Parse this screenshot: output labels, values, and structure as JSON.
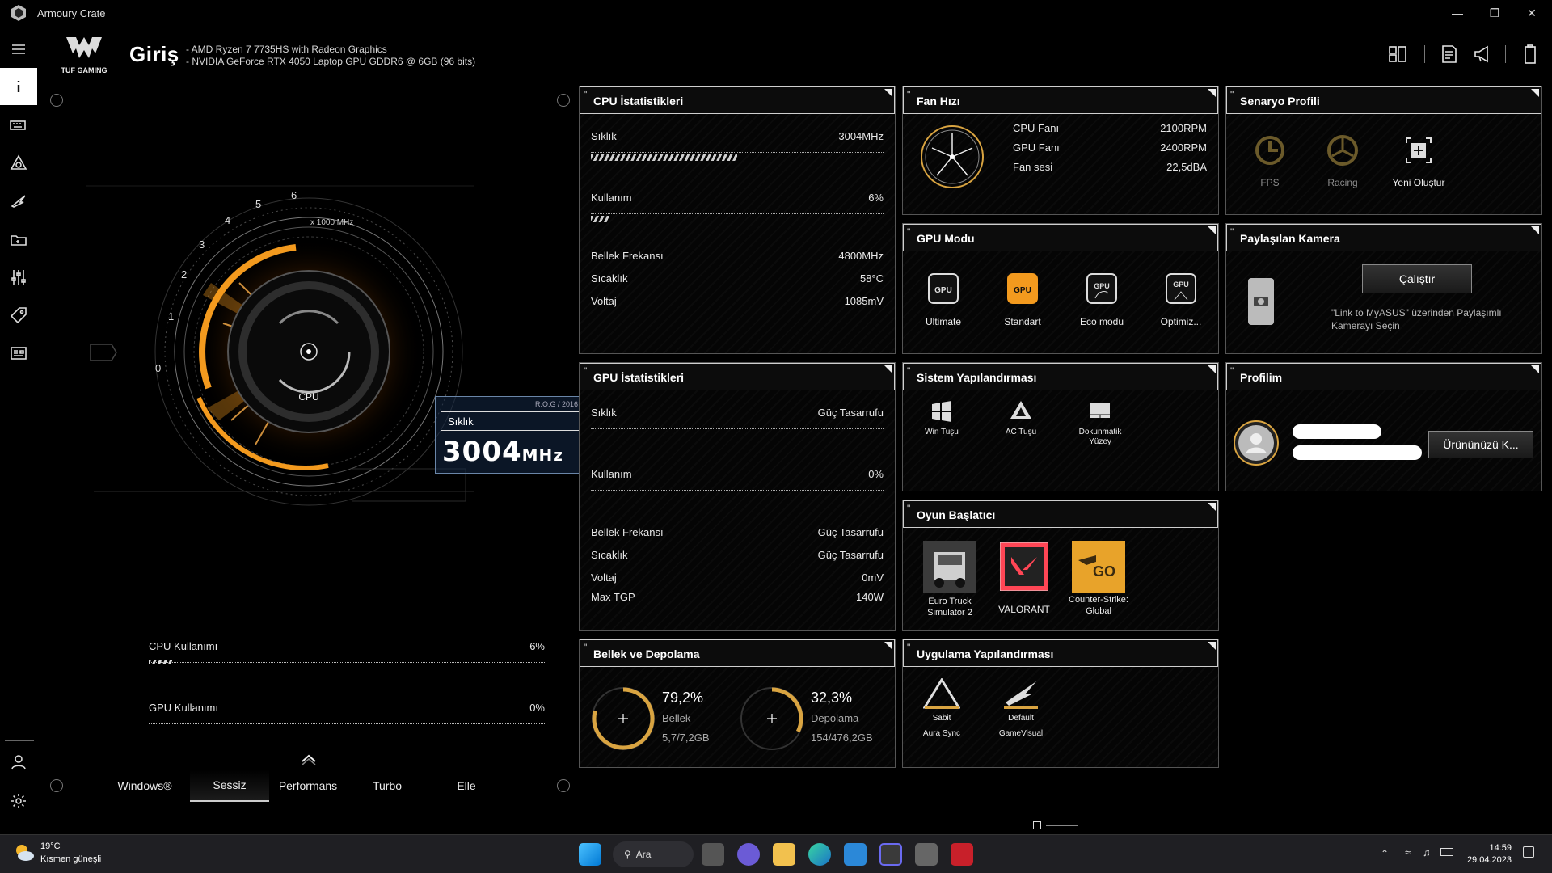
{
  "window": {
    "title": "Armoury Crate"
  },
  "header": {
    "brand": "TUF GAMING",
    "page_title": "Giriş",
    "cpu_line": "-   AMD Ryzen 7 7735HS with Radeon Graphics",
    "gpu_line": "-   NVIDIA GeForce RTX 4050 Laptop GPU GDDR6 @ 6GB (96 bits)"
  },
  "hero": {
    "dial_unit": "x 1000 MHz",
    "dial_ticks": [
      "0",
      "1",
      "2",
      "3",
      "4",
      "5",
      "6"
    ],
    "dial_center": "CPU",
    "badge_tag": "R.O.G / 2016",
    "badge_label": "Sıklık",
    "badge_value": "3004",
    "badge_unit": "MHz",
    "cpu_usage_label": "CPU Kullanımı",
    "cpu_usage_value": "6%",
    "cpu_usage_fraction": 0.06,
    "gpu_usage_label": "GPU Kullanımı",
    "gpu_usage_value": "0%",
    "gpu_usage_fraction": 0.0
  },
  "modes": {
    "tabs": [
      "Windows®",
      "Sessiz",
      "Performans",
      "Turbo",
      "Elle"
    ],
    "active": "Sessiz"
  },
  "cpu_stats": {
    "title": "CPU İstatistikleri",
    "freq_label": "Sıklık",
    "freq_value": "3004MHz",
    "freq_fraction": 0.5,
    "usage_label": "Kullanım",
    "usage_value": "6%",
    "usage_fraction": 0.06,
    "mem_freq_label": "Bellek Frekansı",
    "mem_freq_value": "4800MHz",
    "temp_label": "Sıcaklık",
    "temp_value": "58°C",
    "volt_label": "Voltaj",
    "volt_value": "1085mV"
  },
  "gpu_stats": {
    "title": "GPU İstatistikleri",
    "freq_label": "Sıklık",
    "freq_value": "Güç Tasarrufu",
    "usage_label": "Kullanım",
    "usage_value": "0%",
    "mem_freq_label": "Bellek Frekansı",
    "mem_freq_value": "Güç Tasarrufu",
    "temp_label": "Sıcaklık",
    "temp_value": "Güç Tasarrufu",
    "volt_label": "Voltaj",
    "volt_value": "0mV",
    "tgp_label": "Max TGP",
    "tgp_value": "140W"
  },
  "memory": {
    "title": "Bellek ve Depolama",
    "ram_percent": "79,2%",
    "ram_fraction": 0.792,
    "ram_label": "Bellek",
    "ram_detail": "5,7/7,2GB",
    "disk_percent": "32,3%",
    "disk_fraction": 0.323,
    "disk_label": "Depolama",
    "disk_detail": "154/476,2GB"
  },
  "fan": {
    "title": "Fan Hızı",
    "rows": [
      {
        "label": "CPU Fanı",
        "value": "2100RPM"
      },
      {
        "label": "GPU Fanı",
        "value": "2400RPM"
      },
      {
        "label": "Fan sesi",
        "value": "22,5dBA"
      }
    ]
  },
  "gpu_mode": {
    "title": "GPU Modu",
    "items": [
      "Ultimate",
      "Standart",
      "Eco modu",
      "Optimiz..."
    ],
    "chip_text": "GPU",
    "active": "Standart"
  },
  "system_config": {
    "title": "Sistem Yapılandırması",
    "items": [
      "Win Tuşu",
      "AC Tuşu",
      "Dokunmatik Yüzey"
    ]
  },
  "game_launcher": {
    "title": "Oyun Başlatıcı",
    "games": [
      "Euro Truck Simulator 2",
      "VALORANT",
      "Counter-Strike: Global"
    ],
    "csgo_badge": "GO"
  },
  "app_config": {
    "title": "Uygulama Yapılandırması",
    "items": [
      {
        "value": "Sabit",
        "label": "Aura Sync"
      },
      {
        "value": "Default",
        "label": "GameVisual"
      }
    ]
  },
  "scenario": {
    "title": "Senaryo Profili",
    "items": [
      "FPS",
      "Racing",
      "Yeni Oluştur"
    ]
  },
  "camera": {
    "title": "Paylaşılan Kamera",
    "button": "Çalıştır",
    "description": "\"Link to MyASUS\" üzerinden Paylaşımlı Kamerayı Seçin"
  },
  "profile": {
    "title": "Profilim",
    "button": "Ürününüzü K..."
  },
  "taskbar": {
    "weather_temp": "19°C",
    "weather_cond": "Kısmen güneşli",
    "search": "Ara",
    "time": "14:59",
    "date": "29.04.2023"
  },
  "colors": {
    "accent_orange": "#f39a1e",
    "accent_gold": "#d9a441",
    "card_border": "#cfcfcf",
    "badge_blue": "#6a86a8"
  }
}
